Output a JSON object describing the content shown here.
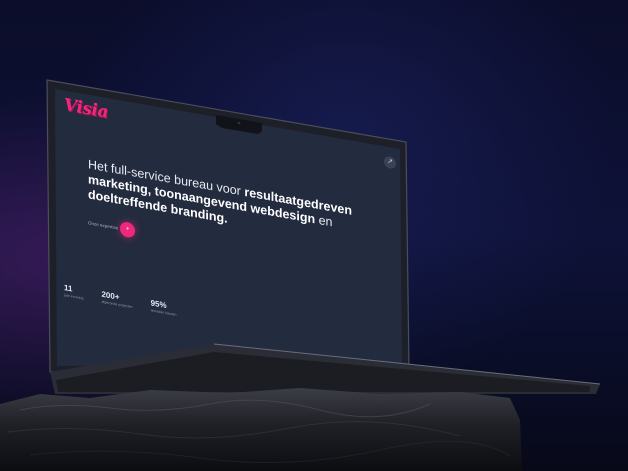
{
  "brand": {
    "logo_text": "Visia",
    "accent_color": "#f0287d"
  },
  "hero": {
    "headline_prefix": "Het full-service bureau voor ",
    "headline_bold_1": "resultaatgedreven marketing, toonaangevend webdesign",
    "headline_mid": " en ",
    "headline_bold_2": "doeltreffende branding.",
    "cta_label": "Onze expertise",
    "cta_icon": "plus-icon"
  },
  "corner_button_icon": "arrow-icon",
  "stats": [
    {
      "value": "11",
      "label": "jaar ervaring"
    },
    {
      "value": "200+",
      "label": "afgeronde projecten"
    },
    {
      "value": "95%",
      "label": "tevreden klanten"
    }
  ]
}
